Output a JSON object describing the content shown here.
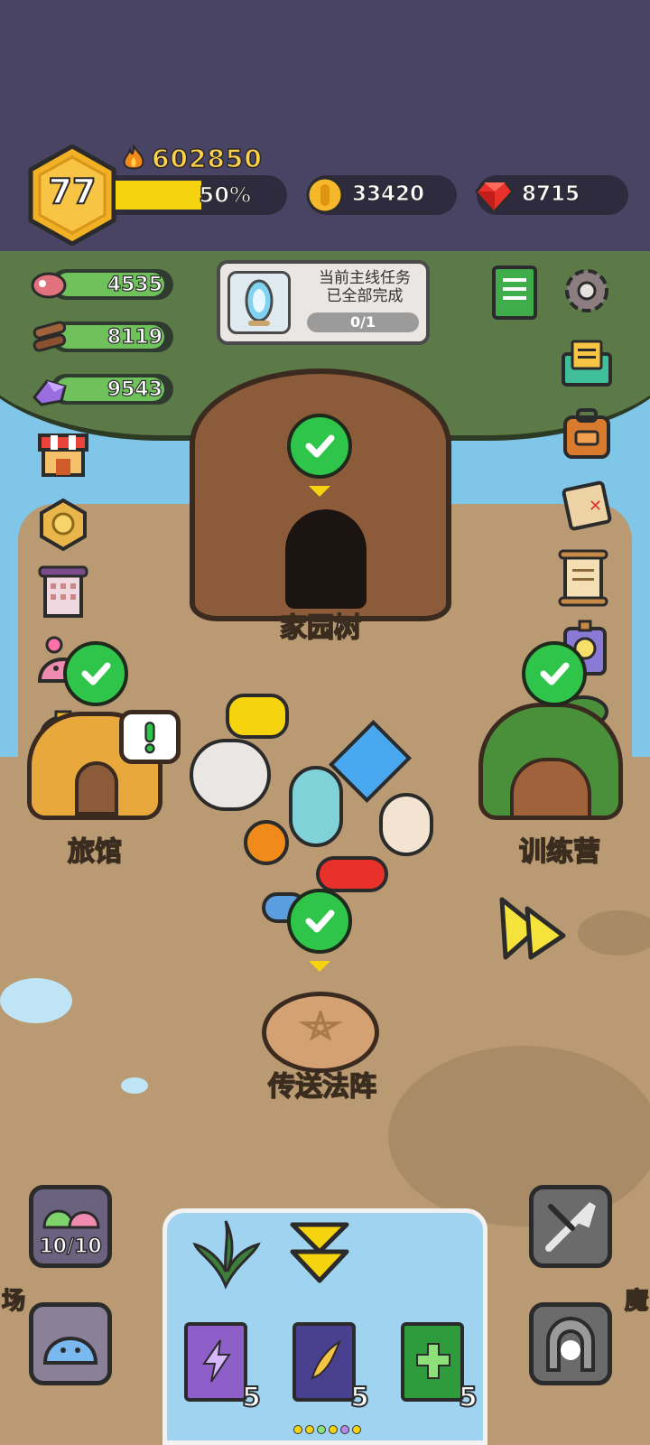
{
  "hud": {
    "level": "77",
    "power": "602850",
    "xp_percent_label": "50%",
    "xp_fraction": 0.5,
    "coins": "33420",
    "gems": "8715"
  },
  "resources": {
    "meat": "4535",
    "wood": "8119",
    "crystal": "9543"
  },
  "task": {
    "line1": "当前主线任务",
    "line2": "已全部完成",
    "progress": "0/1"
  },
  "places": {
    "home_tree": "家园树",
    "inn": "旅馆",
    "training_camp": "训练营",
    "teleport_circle": "传送法阵",
    "left_edge": "场",
    "right_edge": "魔"
  },
  "slime_counter": "10/10",
  "books": [
    {
      "count": "5",
      "color": "#8e5fc9",
      "icon": "lightning-icon"
    },
    {
      "count": "5",
      "color": "#4a4090",
      "icon": "wing-icon"
    },
    {
      "count": "5",
      "color": "#2e9b3d",
      "icon": "cross-icon"
    }
  ],
  "colors": {
    "hud_bg": "#4a4464",
    "xp_fill": "#f5d40f",
    "check_green": "#2ec54a",
    "ground": "#b99a73"
  }
}
